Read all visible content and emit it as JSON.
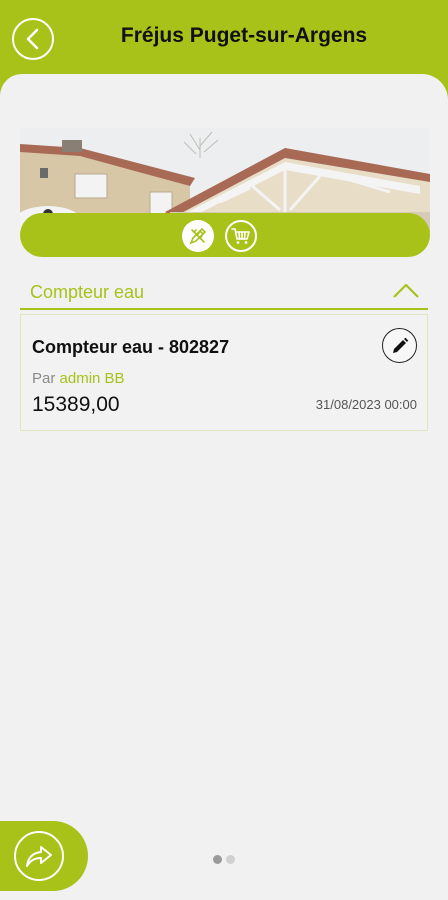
{
  "header": {
    "title": "Fréjus Puget-sur-Argens",
    "back_icon": "chevron-left-icon"
  },
  "photo": {
    "description_icon": "building-photo",
    "actions": [
      {
        "icon": "pencil-ruler-icon"
      },
      {
        "icon": "shopping-cart-icon"
      }
    ]
  },
  "section": {
    "title": "Compteur eau",
    "chevron_icon": "chevron-up-icon",
    "expanded": true
  },
  "meter": {
    "title": "Compteur eau - 802827",
    "by_prefix": "Par",
    "by_name": "admin BB",
    "value": "15389,00",
    "date": "31/08/2023 00:00",
    "edit_icon": "pencil-icon"
  },
  "footer": {
    "fab_icon": "share-arrow-icon",
    "page_count": 2,
    "active_page": 1
  },
  "colors": {
    "accent": "#a8c21a",
    "background": "#f1f1f1",
    "text": "#111111"
  }
}
